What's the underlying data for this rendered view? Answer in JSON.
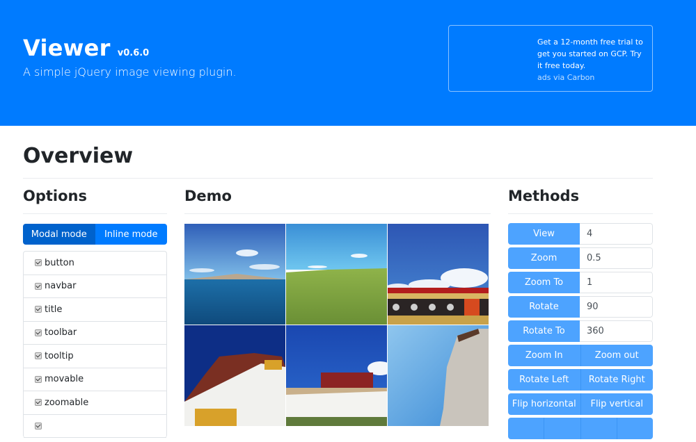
{
  "header": {
    "title": "Viewer",
    "version": "v0.6.0",
    "tagline": "A simple jQuery image viewing plugin.",
    "ad": {
      "text": "Get a 12-month free trial to get you started on GCP. Try it free today.",
      "via": "ads via Carbon"
    },
    "brand_color": "#007bff"
  },
  "overview": {
    "title": "Overview"
  },
  "options": {
    "title": "Options",
    "modes": [
      {
        "label": "Modal mode",
        "active": true
      },
      {
        "label": "Inline mode",
        "active": false
      }
    ],
    "items": [
      {
        "label": "button",
        "checked": true
      },
      {
        "label": "navbar",
        "checked": true
      },
      {
        "label": "title",
        "checked": true
      },
      {
        "label": "toolbar",
        "checked": true
      },
      {
        "label": "tooltip",
        "checked": true
      },
      {
        "label": "movable",
        "checked": true
      },
      {
        "label": "zoomable",
        "checked": true
      },
      {
        "label": "",
        "checked": true
      }
    ]
  },
  "demo": {
    "title": "Demo",
    "images": [
      {
        "name": "lake-mountain"
      },
      {
        "name": "grassland"
      },
      {
        "name": "temple-roof"
      },
      {
        "name": "potala-palace-1"
      },
      {
        "name": "potala-palace-2"
      },
      {
        "name": "palace-wall"
      }
    ]
  },
  "methods": {
    "title": "Methods",
    "inputs": [
      {
        "label": "View",
        "value": "4"
      },
      {
        "label": "Zoom",
        "value": "0.5"
      },
      {
        "label": "Zoom To",
        "value": "1"
      },
      {
        "label": "Rotate",
        "value": "90"
      },
      {
        "label": "Rotate To",
        "value": "360"
      }
    ],
    "pairs": [
      [
        "Zoom In",
        "Zoom out"
      ],
      [
        "Rotate Left",
        "Rotate Right"
      ],
      [
        "Flip horizontal",
        "Flip vertical"
      ]
    ],
    "button_color": "#4da3ff"
  }
}
